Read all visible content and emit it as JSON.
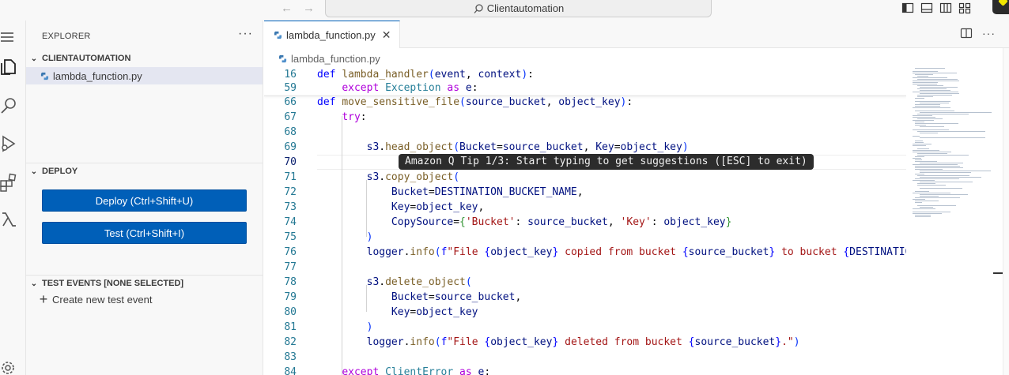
{
  "titlebar": {
    "back_icon": "arrow-left-icon",
    "forward_icon": "arrow-right-icon",
    "search_label": "Clientautomation"
  },
  "activity": {
    "items": [
      "menu-icon",
      "files-icon",
      "search-icon",
      "run-debug-icon",
      "extensions-icon",
      "lambda-icon",
      "settings-icon"
    ]
  },
  "sidebar": {
    "title": "EXPLORER",
    "more": "···",
    "folder": "CLIENTAUTOMATION",
    "file": "lambda_function.py",
    "deploy_section": "DEPLOY",
    "deploy_button": "Deploy (Ctrl+Shift+U)",
    "test_button": "Test (Ctrl+Shift+I)",
    "test_events_section": "TEST EVENTS [NONE SELECTED]",
    "create_event": "Create new test event"
  },
  "editor": {
    "tab_label": "lambda_function.py",
    "breadcrumb": "lambda_function.py",
    "active_line": "70",
    "tip": "Amazon Q Tip 1/3: Start typing to get suggestions ([ESC] to exit)",
    "lines": [
      {
        "n": "16",
        "t": "def lambda_handler(event, context):"
      },
      {
        "n": "59",
        "t": "    except Exception as e:"
      },
      {
        "n": "66",
        "t": "def move_sensitive_file(source_bucket, object_key):"
      },
      {
        "n": "67",
        "t": "    try:"
      },
      {
        "n": "68",
        "t": ""
      },
      {
        "n": "69",
        "t": "        s3.head_object(Bucket=source_bucket, Key=object_key)"
      },
      {
        "n": "70",
        "t": ""
      },
      {
        "n": "71",
        "t": "        s3.copy_object("
      },
      {
        "n": "72",
        "t": "            Bucket=DESTINATION_BUCKET_NAME,"
      },
      {
        "n": "73",
        "t": "            Key=object_key,"
      },
      {
        "n": "74",
        "t": "            CopySource={'Bucket': source_bucket, 'Key': object_key}"
      },
      {
        "n": "75",
        "t": "        )"
      },
      {
        "n": "76",
        "t": "        logger.info(f\"File {object_key} copied from bucket {source_bucket} to bucket {DESTINATION_"
      },
      {
        "n": "77",
        "t": ""
      },
      {
        "n": "78",
        "t": "        s3.delete_object("
      },
      {
        "n": "79",
        "t": "            Bucket=source_bucket,"
      },
      {
        "n": "80",
        "t": "            Key=object_key"
      },
      {
        "n": "81",
        "t": "        )"
      },
      {
        "n": "82",
        "t": "        logger.info(f\"File {object_key} deleted from bucket {source_bucket}.\")"
      },
      {
        "n": "83",
        "t": ""
      },
      {
        "n": "84",
        "t": "    except ClientError as e:"
      }
    ]
  }
}
